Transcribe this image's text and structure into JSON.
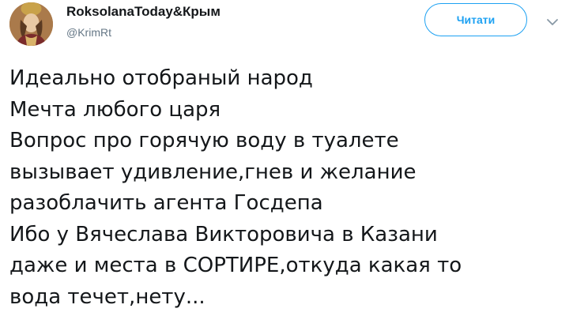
{
  "author": {
    "display_name": "RoksolanaToday&Крым",
    "handle": "@KrimRt",
    "avatar_icon": "portrait-avatar"
  },
  "actions": {
    "follow_label": "Читати",
    "menu_icon": "chevron-down-icon"
  },
  "colors": {
    "accent": "#1da1f2",
    "text": "#14171a",
    "muted": "#657786"
  },
  "tweet": {
    "lines": [
      "Идеально отобраный народ",
      "Мечта любого царя",
      "Вопрос про горячую воду в туалете",
      "вызывает удивление,гнев и желание",
      "разоблачить агента Госдепа",
      "Ибо у Вячеслава Викторовича в Казани",
      "даже и места в СОРТИРЕ,откуда какая то",
      "вода течет,нету..."
    ]
  }
}
